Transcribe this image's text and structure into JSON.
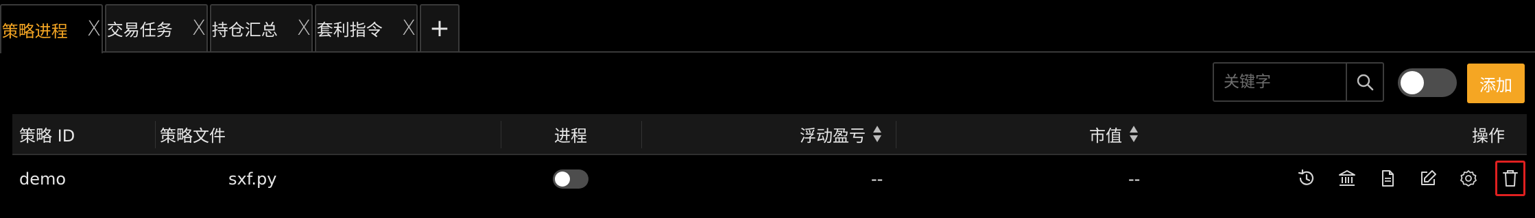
{
  "tabs": [
    {
      "label": "策略进程",
      "active": true
    },
    {
      "label": "交易任务",
      "active": false
    },
    {
      "label": "持仓汇总",
      "active": false
    },
    {
      "label": "套利指令",
      "active": false
    }
  ],
  "tab_close_glyph": "X",
  "add_tab_glyph": "+",
  "toolbar": {
    "search_placeholder": "关键字",
    "add_label": "添加"
  },
  "table": {
    "headers": {
      "strategy_id": "策略 ID",
      "strategy_file": "策略文件",
      "process": "进程",
      "floating_pnl": "浮动盈亏",
      "market_value": "市值",
      "actions": "操作"
    },
    "rows": [
      {
        "strategy_id": "demo",
        "strategy_file": "sxf.py",
        "process_on": false,
        "floating_pnl": "--",
        "market_value": "--"
      }
    ]
  },
  "row_action_icons": [
    "history-icon",
    "bank-icon",
    "file-icon",
    "edit-icon",
    "gear-icon",
    "trash-icon"
  ],
  "colors": {
    "accent": "#f5a623",
    "background": "#000000",
    "header_bg": "#181818",
    "highlight_border": "#e02020"
  }
}
